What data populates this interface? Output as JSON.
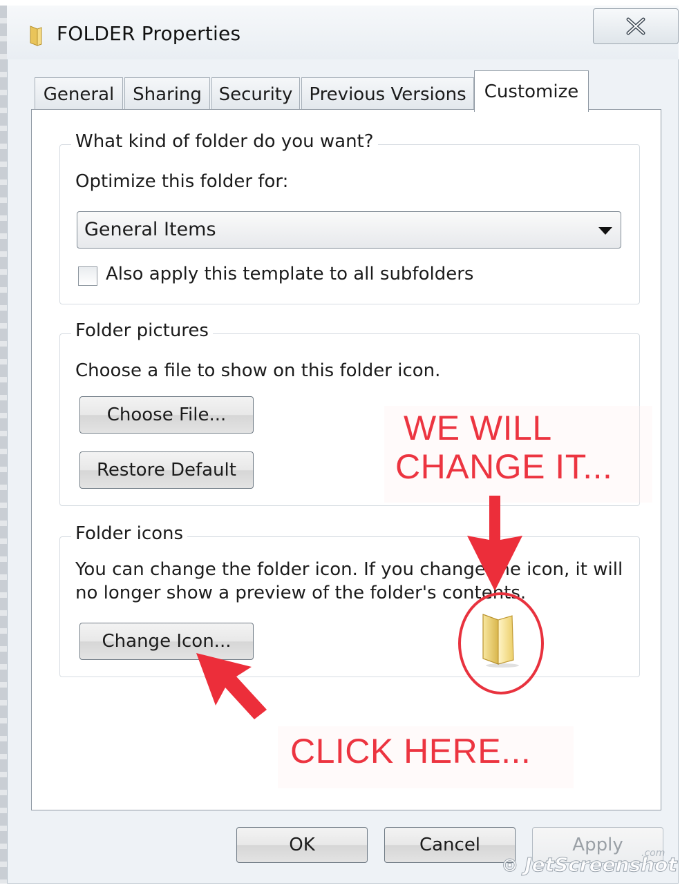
{
  "window": {
    "title": "FOLDER Properties",
    "close_icon": "close-icon"
  },
  "tabs": [
    {
      "label": "General",
      "active": false
    },
    {
      "label": "Sharing",
      "active": false
    },
    {
      "label": "Security",
      "active": false
    },
    {
      "label": "Previous Versions",
      "active": false
    },
    {
      "label": "Customize",
      "active": true
    }
  ],
  "folder_type": {
    "group_title": "What kind of folder do you want?",
    "optimize_label": "Optimize this folder for:",
    "optimize_value": "General Items",
    "apply_subfolders_label": "Also apply this template to all subfolders",
    "apply_subfolders_checked": false
  },
  "folder_pictures": {
    "group_title": "Folder pictures",
    "description": "Choose a file to show on this folder icon.",
    "choose_file_label": "Choose File...",
    "restore_default_label": "Restore Default"
  },
  "folder_icons": {
    "group_title": "Folder icons",
    "description_line1": "You can change the folder icon. If you change the icon, it will",
    "description_line2": "no longer show a preview of the folder's contents.",
    "change_icon_label": "Change Icon..."
  },
  "annotations": {
    "top_line1": "WE WILL",
    "top_line2": "CHANGE IT...",
    "bottom": "CLICK HERE...",
    "color": "#ec3440"
  },
  "footer": {
    "ok_label": "OK",
    "cancel_label": "Cancel",
    "apply_label": "Apply",
    "apply_enabled": false
  },
  "watermark": {
    "text": "JetScreenshot",
    "suffix": ".com"
  }
}
